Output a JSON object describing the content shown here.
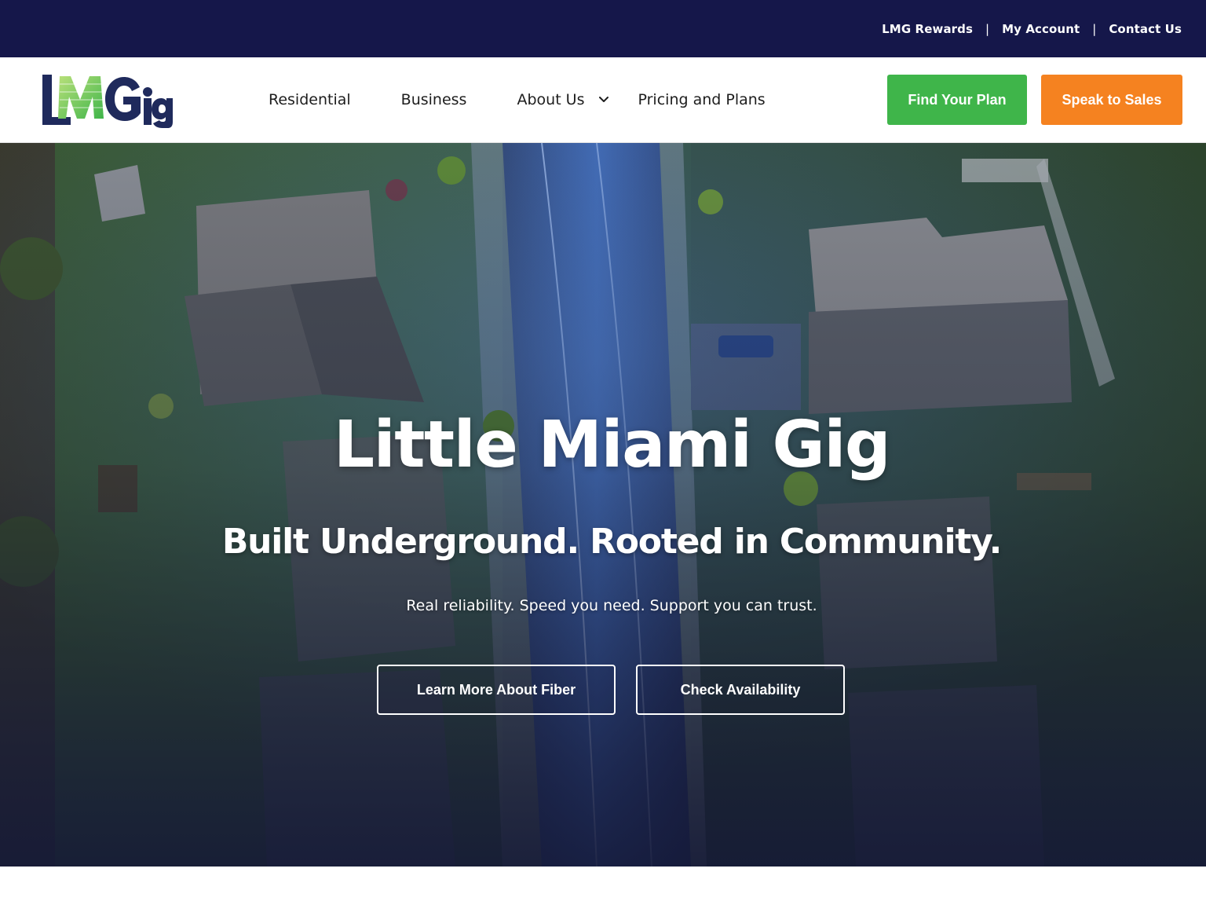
{
  "utility_nav": {
    "rewards": "LMG Rewards",
    "account": "My Account",
    "contact": "Contact Us",
    "separator": "|"
  },
  "brand": {
    "logo_text": "LMGig",
    "colors": {
      "navy": "#15174a",
      "green": "#3fb54a",
      "orange": "#f58220",
      "logo_navy": "#1f2a5c"
    }
  },
  "main_nav": {
    "residential": "Residential",
    "business": "Business",
    "about": "About Us",
    "pricing": "Pricing and Plans"
  },
  "header_buttons": {
    "find_plan": "Find Your Plan",
    "speak_sales": "Speak to Sales"
  },
  "hero": {
    "title": "Little Miami Gig",
    "subtitle": "Built Underground.  Rooted in Community.",
    "tagline": "Real reliability. Speed you need. Support you can trust.",
    "cta_fiber": "Learn More About Fiber",
    "cta_availability": "Check Availability"
  }
}
